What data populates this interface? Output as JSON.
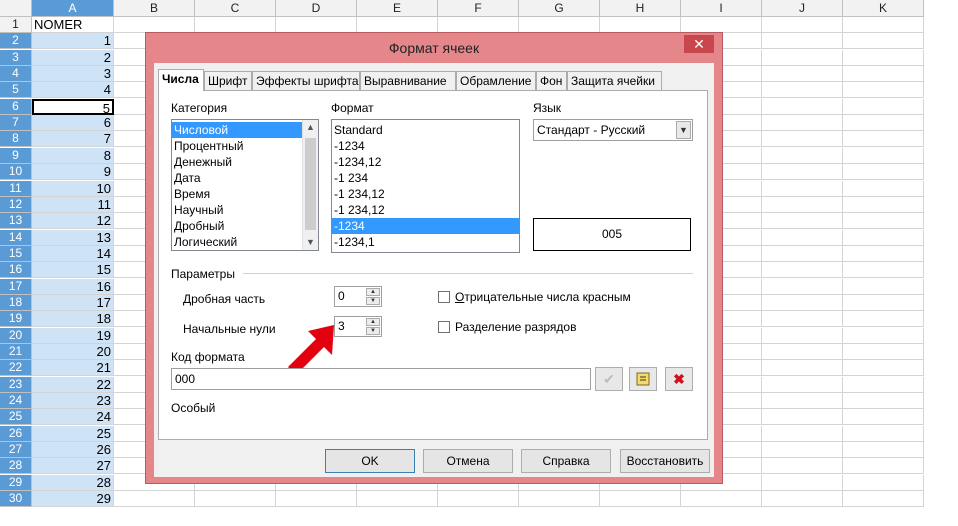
{
  "sheet": {
    "columns": [
      "A",
      "B",
      "C",
      "D",
      "E",
      "F",
      "G",
      "H",
      "I",
      "J",
      "K"
    ],
    "rows": [
      "1",
      "2",
      "3",
      "4",
      "5",
      "6",
      "7",
      "8",
      "9",
      "10",
      "11",
      "12",
      "13",
      "14",
      "15",
      "16",
      "17",
      "18",
      "19",
      "20",
      "21",
      "22",
      "23",
      "24",
      "25",
      "26",
      "27",
      "28",
      "29",
      "30"
    ],
    "col_a_values": [
      "NOMER",
      "1",
      "2",
      "3",
      "4",
      "5",
      "6",
      "7",
      "8",
      "9",
      "10",
      "11",
      "12",
      "13",
      "14",
      "15",
      "16",
      "17",
      "18",
      "19",
      "20",
      "21",
      "22",
      "23",
      "24",
      "25",
      "26",
      "27",
      "28",
      "29"
    ]
  },
  "dialog": {
    "title": "Формат ячеек",
    "close_glyph": "✕",
    "tabs": [
      "Числа",
      "Шрифт",
      "Эффекты шрифта",
      "Выравнивание",
      "Обрамление",
      "Фон",
      "Защита ячейки"
    ],
    "category_label": "Категория",
    "categories": [
      "Числовой",
      "Процентный",
      "Денежный",
      "Дата",
      "Время",
      "Научный",
      "Дробный",
      "Логический"
    ],
    "category_selected": "Числовой",
    "format_label": "Формат",
    "formats": [
      "Standard",
      "-1234",
      "-1234,12",
      "-1 234",
      "-1 234,12",
      "-1 234,12",
      "-1234",
      "-1234,1"
    ],
    "format_selected_index": 6,
    "language_label": "Язык",
    "language_value": "Стандарт - Русский",
    "preview_value": "005",
    "params_label": "Параметры",
    "decimal_label": "Дробная часть",
    "decimal_value": "0",
    "leading_zeros_label": "Начальные нули",
    "leading_zeros_value": "3",
    "negative_red_label": "Отрицательные числа красным",
    "thousands_sep_label": "Разделение разрядов",
    "format_code_label": "Код формата",
    "format_code_value": "000",
    "format_type": "Особый",
    "buttons": {
      "ok": "OK",
      "cancel": "Отмена",
      "help": "Справка",
      "reset": "Восстановить"
    }
  },
  "colors": {
    "accent": "#e5868b",
    "selection": "#3399ff",
    "arrow": "#e3000f"
  }
}
